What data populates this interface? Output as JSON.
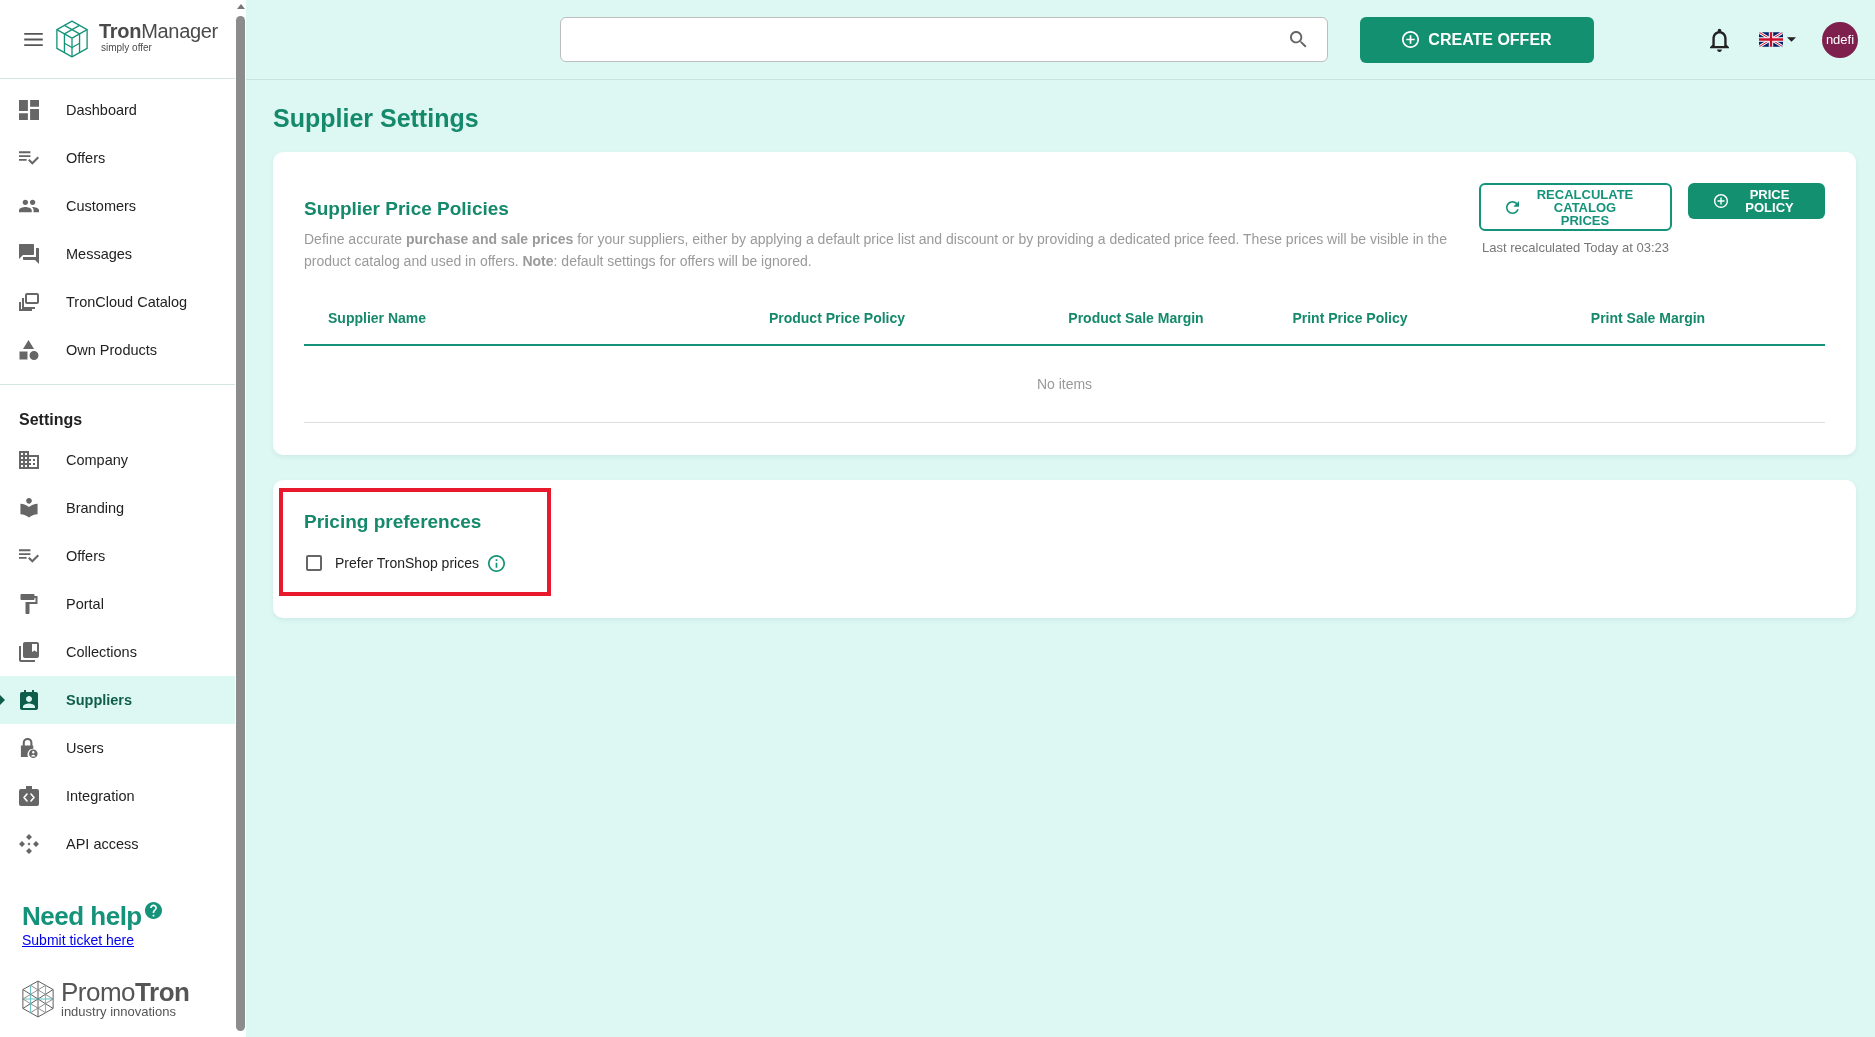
{
  "sidebar": {
    "brand": {
      "name": "**Tron**Manager",
      "tagline": "simply offer"
    },
    "main_items": [
      {
        "label": "Dashboard",
        "selected": false
      },
      {
        "label": "Offers",
        "selected": false
      },
      {
        "label": "Customers",
        "selected": false
      },
      {
        "label": "Messages",
        "selected": false
      },
      {
        "label": "TronCloud Catalog",
        "selected": false
      },
      {
        "label": "Own Products",
        "selected": false
      }
    ],
    "settings_heading": "Settings",
    "settings_items": [
      {
        "label": "Company",
        "selected": false
      },
      {
        "label": "Branding",
        "selected": false
      },
      {
        "label": "Offers",
        "selected": false
      },
      {
        "label": "Portal",
        "selected": false
      },
      {
        "label": "Collections",
        "selected": false
      },
      {
        "label": "Suppliers",
        "selected": true
      },
      {
        "label": "Users",
        "selected": false
      },
      {
        "label": "Integration",
        "selected": false
      },
      {
        "label": "API access",
        "selected": false
      }
    ],
    "help": {
      "title": "Need help",
      "link": "Submit ticket here"
    },
    "footer_brand": {
      "name": "Promo**Tron**",
      "tagline": "industry innovations"
    }
  },
  "topbar": {
    "create_button": "CREATE OFFER",
    "avatar_text": "ndefi"
  },
  "page_title": "Supplier Settings",
  "price_policies": {
    "title": "Supplier Price Policies",
    "description": "Define accurate **purchase and sale prices** for your suppliers, either by applying a default price list and discount or by providing a dedicated price feed. These prices will be visible in the product catalog and used in offers. **Note**: default settings for offers will be ignored.",
    "recalculate_button": "RECALCULATE CATALOG PRICES",
    "last_recalculated": "Last recalculated Today at 03:23",
    "add_button": "PRICE POLICY",
    "table": {
      "columns": [
        "Supplier Name",
        "Product Price Policy",
        "Product Sale Margin",
        "Print Price Policy",
        "Print Sale Margin"
      ],
      "empty_text": "No items"
    }
  },
  "pricing_preferences": {
    "title": "Pricing preferences",
    "highlighted": true,
    "options": [
      {
        "label": "Prefer TronShop prices",
        "checked": false
      }
    ]
  }
}
